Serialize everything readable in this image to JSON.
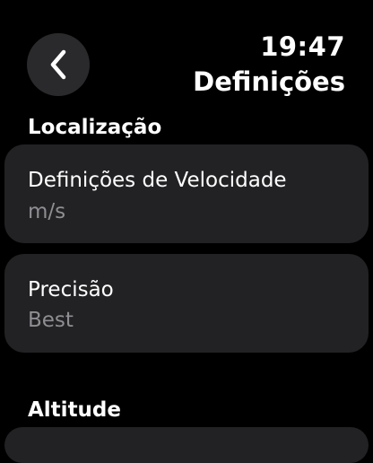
{
  "header": {
    "time": "19:47",
    "title": "Definições"
  },
  "sections": [
    {
      "header": "Localização",
      "items": [
        {
          "label": "Definições de Velocidade",
          "value": "m/s"
        },
        {
          "label": "Precisão",
          "value": "Best"
        }
      ]
    },
    {
      "header": "Altitude"
    }
  ],
  "colors": {
    "background": "#000000",
    "card": "#222224",
    "secondary_text": "#8e8e93"
  }
}
